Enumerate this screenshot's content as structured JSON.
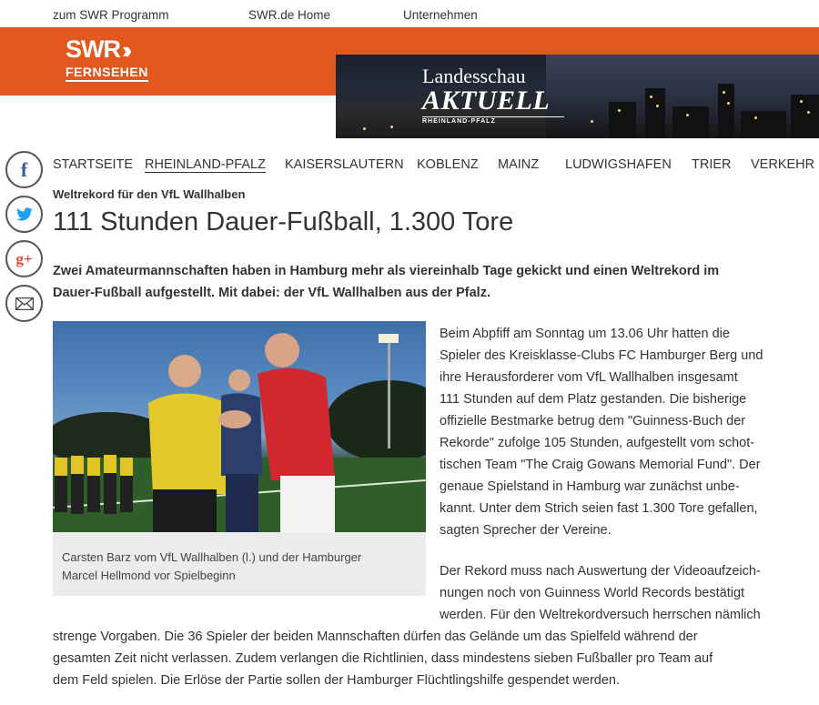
{
  "topnav": {
    "program": "zum SWR Programm",
    "home": "SWR.de Home",
    "company": "Unternehmen"
  },
  "logo": {
    "swr": "SWR",
    "chevrons": "»",
    "sub": "FERNSEHEN"
  },
  "banner": {
    "line1": "Landesschau",
    "line2": "AKTUELL",
    "line3": "RHEINLAND-PFALZ"
  },
  "social": {
    "facebook": "f",
    "twitter": "twitter-bird",
    "googleplus": "g+",
    "email": "envelope"
  },
  "mainnav": {
    "items": [
      "STARTSEITE",
      "RHEINLAND-PFALZ",
      "KAISERSLAUTERN",
      "KOBLENZ",
      "MAINZ",
      "LUDWIGSHAFEN",
      "TRIER",
      "VERKEHR"
    ],
    "active": "RHEINLAND-PFALZ"
  },
  "article": {
    "kicker": "Weltrekord für den VfL Wallhalben",
    "headline": "111 Stunden Dauer-Fußball, 1.300 Tore",
    "teaser": [
      "Zwei Amateurmannschaften haben in Hamburg mehr als viereinhalb Tage gekickt und einen Weltrekord im",
      "Dauer-Fußball aufgestellt. Mit dabei: der VfL Wallhalben aus der Pfalz."
    ],
    "caption": [
      "Carsten Barz vom VfL Wallhalben (l.) und der Hamburger",
      "Marcel Hellmond vor Spielbeginn"
    ],
    "para1": [
      "Beim Abpfiff am Sonntag um 13.06 Uhr hatten die",
      "Spieler des Kreisklasse-Clubs FC Hamburger Berg und",
      "ihre Herausforderer vom VfL Wallhalben insgesamt",
      "111 Stunden auf dem Platz gestanden. Die bisherige",
      "offizielle Bestmarke betrug dem \"Guinness-Buch der",
      "Rekorde\" zufolge 105 Stunden, aufgestellt vom schot-",
      "tischen Team \"The Craig Gowans Memorial Fund\". Der",
      "genaue Spielstand in Hamburg war zunächst unbe-",
      "kannt. Unter dem Strich seien fast 1.300 Tore gefallen,",
      "sagten Sprecher der Vereine."
    ],
    "para2_narrow": [
      "Der Rekord muss nach Auswertung der Videoaufzeich-",
      "nungen noch von Guinness World Records bestätigt",
      "werden. Für den Weltrekordversuch herrschen nämlich"
    ],
    "para2_wide": [
      "strenge Vorgaben. Die 36 Spieler der beiden Mannschaften dürfen das Gelände um das Spielfeld während der",
      "gesamten Zeit nicht verlassen. Zudem verlangen die Richtlinien, dass mindestens sieben Fußballer pro Team auf",
      "dem Feld spielen. Die Erlöse der Partie sollen der Hamburger Flüchtlingshilfe gespendet werden."
    ]
  }
}
